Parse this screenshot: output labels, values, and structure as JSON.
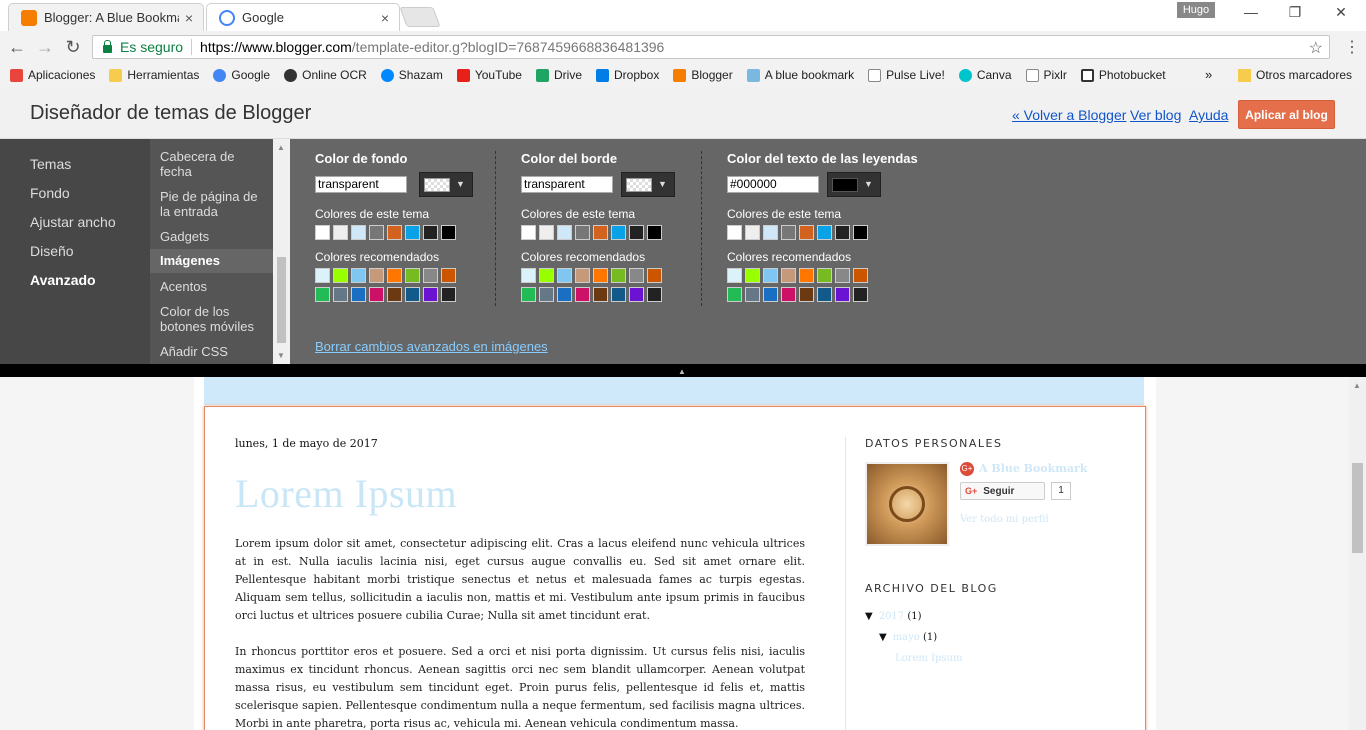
{
  "browser": {
    "tabs": [
      {
        "title": "Blogger: A Blue Bookmar",
        "close": "×"
      },
      {
        "title": "Google",
        "close": "×"
      }
    ],
    "user": "Hugo",
    "window_controls": {
      "minimize": "—",
      "restore": "❐",
      "close": "✕"
    },
    "nav": {
      "back": "←",
      "forward": "→",
      "reload": "↻"
    },
    "secure_label": "Es seguro",
    "url_host": "https://www.blogger.com",
    "url_rest": "/template-editor.g?blogID=7687459668836481396",
    "star": "☆",
    "menu": "⋮",
    "bookmarks": [
      {
        "label": "Aplicaciones",
        "color": "#e8453c"
      },
      {
        "label": "Herramientas",
        "color": "#f7cb4d"
      },
      {
        "label": "Google",
        "color": "#4285f4"
      },
      {
        "label": "Online OCR",
        "color": "#333333"
      },
      {
        "label": "Shazam",
        "color": "#0088ff"
      },
      {
        "label": "YouTube",
        "color": "#e62117"
      },
      {
        "label": "Drive",
        "color": "#1fa463"
      },
      {
        "label": "Dropbox",
        "color": "#007ee5"
      },
      {
        "label": "Blogger",
        "color": "#f57d00"
      },
      {
        "label": "A blue bookmark",
        "color": "#7ab8e0"
      },
      {
        "label": "Pulse Live!",
        "color": "#888888"
      },
      {
        "label": "Canva",
        "color": "#00c4cc"
      },
      {
        "label": "Pixlr",
        "color": "#888888"
      },
      {
        "label": "Photobucket",
        "color": "#333333"
      }
    ],
    "bookmarks_more": "»",
    "other_bookmarks": "Otros marcadores"
  },
  "designer": {
    "title": "Diseñador de temas de Blogger",
    "links": {
      "back": "« Volver a Blogger",
      "view": "Ver blog",
      "help": "Ayuda"
    },
    "apply": "Aplicar al blog",
    "left_nav": [
      "Temas",
      "Fondo",
      "Ajustar ancho",
      "Diseño",
      "Avanzado"
    ],
    "sub_nav": [
      "Cabecera de fecha",
      "Pie de página de la entrada",
      "Gadgets",
      "Imágenes",
      "Acentos",
      "Color de los botones móviles",
      "Añadir CSS"
    ],
    "columns": [
      {
        "title": "Color de fondo",
        "value": "transparent"
      },
      {
        "title": "Color del borde",
        "value": "transparent"
      },
      {
        "title": "Color del texto de las leyendas",
        "value": "#000000"
      }
    ],
    "theme_colors_label": "Colores de este tema",
    "recommended_label": "Colores recomendados",
    "theme_colors": [
      "#ffffff",
      "#eeeeee",
      "#cfe7f6",
      "#777777",
      "#d3621e",
      "#0aa2e6",
      "#222222",
      "#000000"
    ],
    "recommended_row1": [
      "#dcf2fb",
      "#99ff00",
      "#7fc7f0",
      "#c49a7a",
      "#ff7700",
      "#77bb22",
      "#888888",
      "#cc5500"
    ],
    "recommended_row2": [
      "#22bb55",
      "#667788",
      "#1b6fc2",
      "#cc1166",
      "#6b3a12",
      "#125a8a",
      "#6b13d3",
      "#222222"
    ],
    "reset_link": "Borrar cambios avanzados en imágenes"
  },
  "preview": {
    "date": "lunes, 1 de mayo de 2017",
    "post_title": "Lorem Ipsum",
    "paragraphs": [
      "Lorem ipsum dolor sit amet, consectetur adipiscing elit. Cras a lacus eleifend nunc vehicula ultrices at in est. Nulla iaculis lacinia nisi, eget cursus augue convallis eu. Sed sit amet ornare elit. Pellentesque habitant morbi tristique senectus et netus et malesuada fames ac turpis egestas. Aliquam sem tellus, sollicitudin a iaculis non, mattis et mi. Vestibulum ante ipsum primis in faucibus orci luctus et ultrices posuere cubilia Curae; Nulla sit amet tincidunt erat.",
      "In rhoncus porttitor eros et posuere. Sed a orci et nisi porta dignissim. Ut cursus felis nisi, iaculis maximus ex tincidunt rhoncus. Aenean sagittis orci nec sem blandit ullamcorper. Aenean volutpat massa risus, eu vestibulum sem tincidunt eget. Proin purus felis, pellentesque id felis et, mattis scelerisque sapien. Pellentesque condimentum nulla a neque fermentum, sed facilisis magna ultrices. Morbi in ante pharetra, porta risus ac, vehicula mi. Aenean vehicula condimentum massa."
    ],
    "profile_title": "Datos personales",
    "profile_name": "A Blue Bookmark",
    "follow": "Seguir",
    "follow_count": "1",
    "view_profile": "Ver todo mi perfil",
    "archive_title": "Archivo del blog",
    "archive": {
      "year": "2017",
      "year_count": "(1)",
      "month": "mayo",
      "month_count": "(1)",
      "post": "Lorem Ipsum"
    }
  }
}
